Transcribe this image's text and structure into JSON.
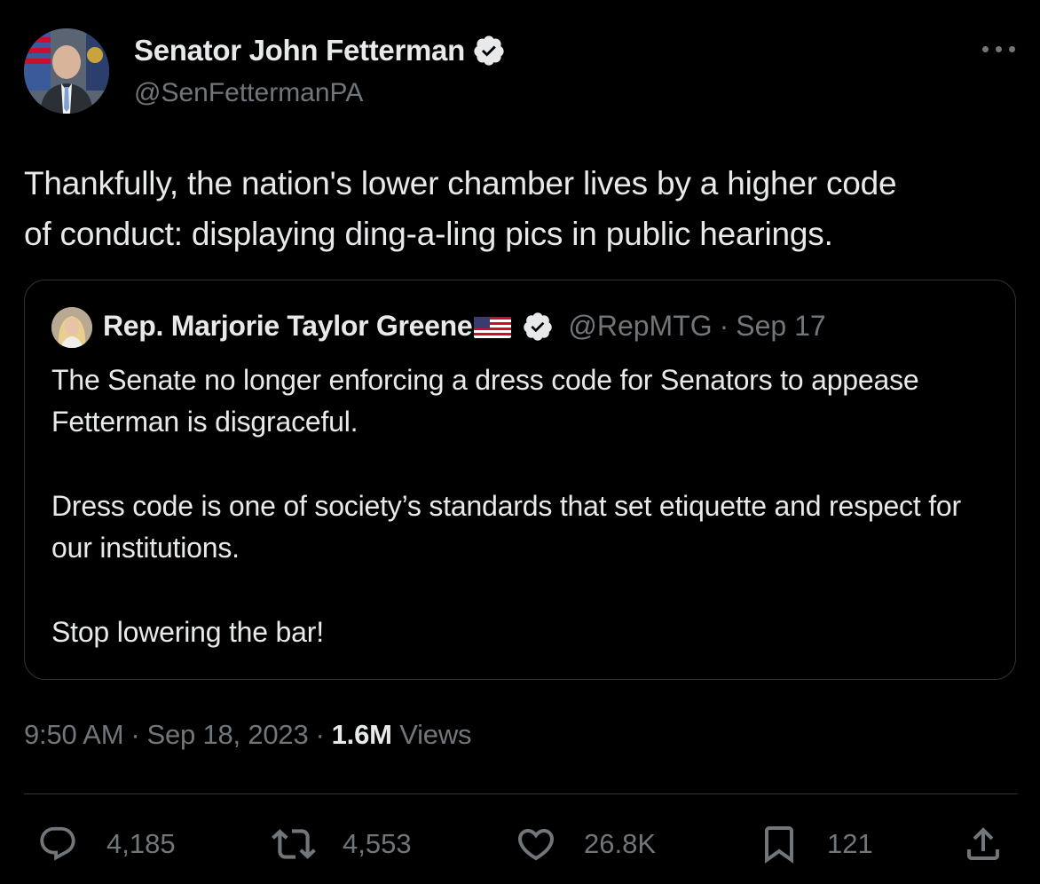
{
  "tweet": {
    "author_name": "Senator John Fetterman",
    "author_handle": "@SenFettermanPA",
    "text_line_1": "Thankfully, the nation's lower chamber lives by a higher code",
    "text_line_2": "of conduct: displaying ding-a-ling pics in public hearings."
  },
  "quoted_tweet": {
    "author_name": "Rep. Marjorie Taylor Greene",
    "author_handle": "@RepMTG",
    "separator": "·",
    "date": "Sep 17",
    "paragraphs": [
      "The Senate no longer enforcing a dress code for Senators to appease Fetterman is disgraceful.",
      "Dress code is one of society’s standards that set etiquette and respect for our institutions.",
      "Stop lowering the bar!"
    ]
  },
  "meta": {
    "time": "9:50 AM",
    "date": "Sep 18, 2023",
    "separator": "·",
    "views_count": "1.6M",
    "views_label": "Views"
  },
  "actions": {
    "replies": "4,185",
    "reposts": "4,553",
    "likes": "26.8K",
    "bookmarks": "121"
  },
  "icons": {
    "verified": "verified-badge-icon",
    "more": "more-options-icon",
    "reply": "reply-icon",
    "repost": "repost-icon",
    "like": "heart-icon",
    "bookmark": "bookmark-icon",
    "share": "share-icon",
    "flag": "us-flag-icon"
  },
  "colors": {
    "background": "#000000",
    "text_primary": "#e7e9ea",
    "text_secondary": "#71767b",
    "border": "#2f3336",
    "verified": "#1d9bf0"
  }
}
